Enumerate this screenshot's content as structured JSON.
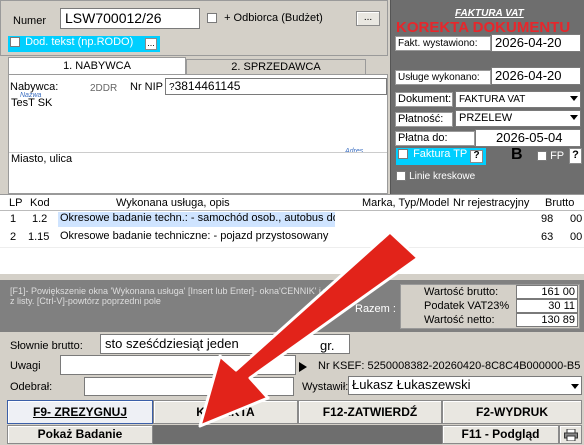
{
  "header": {
    "numer_label": "Numer",
    "numer_value": "LSW700012/26",
    "odbiorca_label": "+ Odbiorca (Budżet)",
    "odbiorca_btn": "...",
    "dod_tekst_label": "Dod. tekst (np.RODO)",
    "dod_tekst_btn": "..."
  },
  "tabs": [
    {
      "label": "1. NABYWCA"
    },
    {
      "label": "2. SPRZEDAWCA"
    }
  ],
  "buyer": {
    "label": "Nabywca:",
    "code_label": "2DDR",
    "nip_label": "Nr NIP",
    "nip_value": "3814461145",
    "nip_prefix": "?",
    "name_hint": "Nazwa",
    "name_value": "TesT SK",
    "address_hint": "Adres",
    "address_value": "Miasto, ulica"
  },
  "invoice": {
    "title": "FAKTURA VAT",
    "subtitle": "KOREKTA DOKUMENTU",
    "fakt_label": "Fakt. wystawiono:",
    "fakt_value": "2026-04-20",
    "usluge_label": "Usługe wykonano:",
    "usluge_value": "2026-04-20",
    "dokument_label": "Dokument:",
    "dokument_value": "FAKTURA VAT",
    "platnosc_label": "Płatność:",
    "platnosc_value": "PRZELEW",
    "platna_label": "Płatna do:",
    "platna_value": "2026-05-04",
    "faktura_tp_label": "Faktura TP",
    "help_q": "?",
    "b_label": "B",
    "fp_label": "FP",
    "linie_label": "Linie kreskowe"
  },
  "table": {
    "headers": [
      "LP",
      "Kod",
      "Wykonana usługa, opis",
      "Marka, Typ/Model",
      "Nr rejestracyjny",
      "Brutto"
    ],
    "rows": [
      {
        "lp": "1",
        "kod": "1.2",
        "opis": "Okresowe badanie techn.: - samochód osob., autobus do",
        "marka": "",
        "nr": "",
        "brutto": "98",
        "extra": "00"
      },
      {
        "lp": "2",
        "kod": "1.15",
        "opis": "Okresowe badanie techniczne: - pojazd przystosowany",
        "marka": "",
        "nr": "",
        "brutto": "63",
        "extra": "00"
      }
    ]
  },
  "info_text": "[F1]- Powiększenie okna 'Wykonana usługa' [Insert lub Enter]- okna'CENNIK' i wybór z listy. [Ctrl-V]-powtórz poprzedni pole",
  "totals": {
    "razem_label": "Razem :",
    "brutto_label": "Wartość brutto:",
    "brutto_value": "161 00",
    "vat_label": "Podatek VAT23%",
    "vat_value": "30 11",
    "netto_label": "Wartość netto:",
    "netto_value": "130 89"
  },
  "slownie": {
    "label": "Słownie brutto:",
    "value": "sto sześćdziesiąt jeden",
    "tail": "gr."
  },
  "uwagi_label": "Uwagi",
  "ksef_text": "Nr KSEF: 5250008382-20260420-8C8C4B000000-B5",
  "odebral_label": "Odebrał:",
  "wystawil_label": "Wystawił:",
  "wystawil_value": "Łukasz Łukaszewski",
  "buttons": {
    "f9": "F9- ZREZYGNUJ",
    "korekta": "KOREKTA",
    "f12": "F12-ZATWIERDŹ",
    "f2": "F2-WYDRUK",
    "pokaz": "Pokaż Badanie",
    "f11": "F11 - Podgląd"
  },
  "colors": {
    "red": "#e8262b",
    "cyan": "#00cfff",
    "panel_dark": "#6e6e6e",
    "arrow": "#e2231a"
  }
}
